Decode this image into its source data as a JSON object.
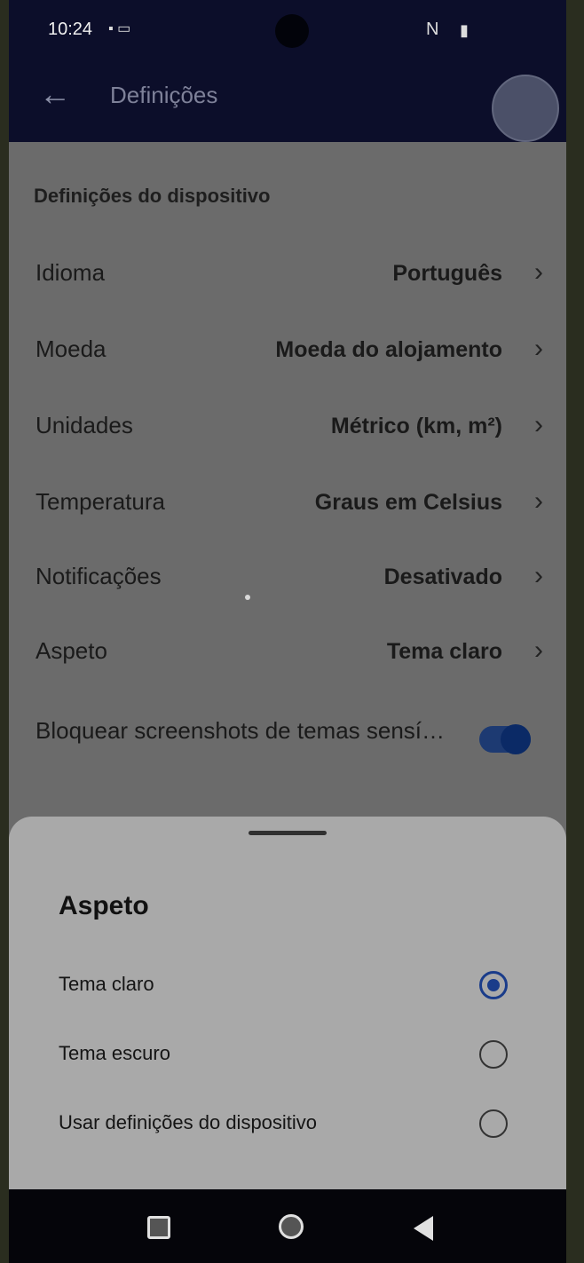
{
  "status_bar": {
    "time": "10:24",
    "left_icons": "▪ ▭",
    "nfc": "N",
    "signal": "▮"
  },
  "app_bar": {
    "back_icon": "←",
    "title": "Definições"
  },
  "settings": {
    "section_title": "Definições do dispositivo",
    "rows": [
      {
        "label": "Idioma",
        "value": "Português",
        "chevron": "›"
      },
      {
        "label": "Moeda",
        "value": "Moeda do alojamento",
        "chevron": "›"
      },
      {
        "label": "Unidades",
        "value": "Métrico (km, m²)",
        "chevron": "›"
      },
      {
        "label": "Temperatura",
        "value": "Graus em Celsius",
        "chevron": "›"
      },
      {
        "label": "Notificações",
        "value": "Desativado",
        "chevron": "›"
      },
      {
        "label": "Aspeto",
        "value": "Tema claro",
        "chevron": "›"
      }
    ],
    "toggle_row": {
      "label": "Bloquear screenshots de temas sensí…",
      "enabled": true
    }
  },
  "sheet": {
    "title": "Aspeto",
    "options": [
      {
        "label": "Tema claro",
        "selected": true
      },
      {
        "label": "Tema escuro",
        "selected": false
      },
      {
        "label": "Usar definições do dispositivo",
        "selected": false
      }
    ]
  },
  "nav_bar": {
    "icons": [
      "recents-icon",
      "home-icon",
      "back-icon"
    ]
  }
}
